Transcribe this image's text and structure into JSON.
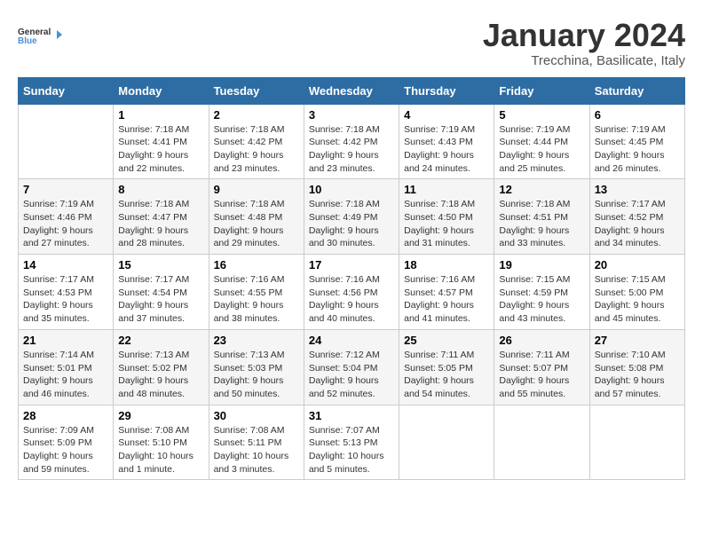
{
  "header": {
    "logo_line1": "General",
    "logo_line2": "Blue",
    "month": "January 2024",
    "location": "Trecchina, Basilicate, Italy"
  },
  "days_of_week": [
    "Sunday",
    "Monday",
    "Tuesday",
    "Wednesday",
    "Thursday",
    "Friday",
    "Saturday"
  ],
  "weeks": [
    [
      {
        "num": "",
        "info": ""
      },
      {
        "num": "1",
        "info": "Sunrise: 7:18 AM\nSunset: 4:41 PM\nDaylight: 9 hours\nand 22 minutes."
      },
      {
        "num": "2",
        "info": "Sunrise: 7:18 AM\nSunset: 4:42 PM\nDaylight: 9 hours\nand 23 minutes."
      },
      {
        "num": "3",
        "info": "Sunrise: 7:18 AM\nSunset: 4:42 PM\nDaylight: 9 hours\nand 23 minutes."
      },
      {
        "num": "4",
        "info": "Sunrise: 7:19 AM\nSunset: 4:43 PM\nDaylight: 9 hours\nand 24 minutes."
      },
      {
        "num": "5",
        "info": "Sunrise: 7:19 AM\nSunset: 4:44 PM\nDaylight: 9 hours\nand 25 minutes."
      },
      {
        "num": "6",
        "info": "Sunrise: 7:19 AM\nSunset: 4:45 PM\nDaylight: 9 hours\nand 26 minutes."
      }
    ],
    [
      {
        "num": "7",
        "info": "Sunrise: 7:19 AM\nSunset: 4:46 PM\nDaylight: 9 hours\nand 27 minutes."
      },
      {
        "num": "8",
        "info": "Sunrise: 7:18 AM\nSunset: 4:47 PM\nDaylight: 9 hours\nand 28 minutes."
      },
      {
        "num": "9",
        "info": "Sunrise: 7:18 AM\nSunset: 4:48 PM\nDaylight: 9 hours\nand 29 minutes."
      },
      {
        "num": "10",
        "info": "Sunrise: 7:18 AM\nSunset: 4:49 PM\nDaylight: 9 hours\nand 30 minutes."
      },
      {
        "num": "11",
        "info": "Sunrise: 7:18 AM\nSunset: 4:50 PM\nDaylight: 9 hours\nand 31 minutes."
      },
      {
        "num": "12",
        "info": "Sunrise: 7:18 AM\nSunset: 4:51 PM\nDaylight: 9 hours\nand 33 minutes."
      },
      {
        "num": "13",
        "info": "Sunrise: 7:17 AM\nSunset: 4:52 PM\nDaylight: 9 hours\nand 34 minutes."
      }
    ],
    [
      {
        "num": "14",
        "info": "Sunrise: 7:17 AM\nSunset: 4:53 PM\nDaylight: 9 hours\nand 35 minutes."
      },
      {
        "num": "15",
        "info": "Sunrise: 7:17 AM\nSunset: 4:54 PM\nDaylight: 9 hours\nand 37 minutes."
      },
      {
        "num": "16",
        "info": "Sunrise: 7:16 AM\nSunset: 4:55 PM\nDaylight: 9 hours\nand 38 minutes."
      },
      {
        "num": "17",
        "info": "Sunrise: 7:16 AM\nSunset: 4:56 PM\nDaylight: 9 hours\nand 40 minutes."
      },
      {
        "num": "18",
        "info": "Sunrise: 7:16 AM\nSunset: 4:57 PM\nDaylight: 9 hours\nand 41 minutes."
      },
      {
        "num": "19",
        "info": "Sunrise: 7:15 AM\nSunset: 4:59 PM\nDaylight: 9 hours\nand 43 minutes."
      },
      {
        "num": "20",
        "info": "Sunrise: 7:15 AM\nSunset: 5:00 PM\nDaylight: 9 hours\nand 45 minutes."
      }
    ],
    [
      {
        "num": "21",
        "info": "Sunrise: 7:14 AM\nSunset: 5:01 PM\nDaylight: 9 hours\nand 46 minutes."
      },
      {
        "num": "22",
        "info": "Sunrise: 7:13 AM\nSunset: 5:02 PM\nDaylight: 9 hours\nand 48 minutes."
      },
      {
        "num": "23",
        "info": "Sunrise: 7:13 AM\nSunset: 5:03 PM\nDaylight: 9 hours\nand 50 minutes."
      },
      {
        "num": "24",
        "info": "Sunrise: 7:12 AM\nSunset: 5:04 PM\nDaylight: 9 hours\nand 52 minutes."
      },
      {
        "num": "25",
        "info": "Sunrise: 7:11 AM\nSunset: 5:05 PM\nDaylight: 9 hours\nand 54 minutes."
      },
      {
        "num": "26",
        "info": "Sunrise: 7:11 AM\nSunset: 5:07 PM\nDaylight: 9 hours\nand 55 minutes."
      },
      {
        "num": "27",
        "info": "Sunrise: 7:10 AM\nSunset: 5:08 PM\nDaylight: 9 hours\nand 57 minutes."
      }
    ],
    [
      {
        "num": "28",
        "info": "Sunrise: 7:09 AM\nSunset: 5:09 PM\nDaylight: 9 hours\nand 59 minutes."
      },
      {
        "num": "29",
        "info": "Sunrise: 7:08 AM\nSunset: 5:10 PM\nDaylight: 10 hours\nand 1 minute."
      },
      {
        "num": "30",
        "info": "Sunrise: 7:08 AM\nSunset: 5:11 PM\nDaylight: 10 hours\nand 3 minutes."
      },
      {
        "num": "31",
        "info": "Sunrise: 7:07 AM\nSunset: 5:13 PM\nDaylight: 10 hours\nand 5 minutes."
      },
      {
        "num": "",
        "info": ""
      },
      {
        "num": "",
        "info": ""
      },
      {
        "num": "",
        "info": ""
      }
    ]
  ]
}
